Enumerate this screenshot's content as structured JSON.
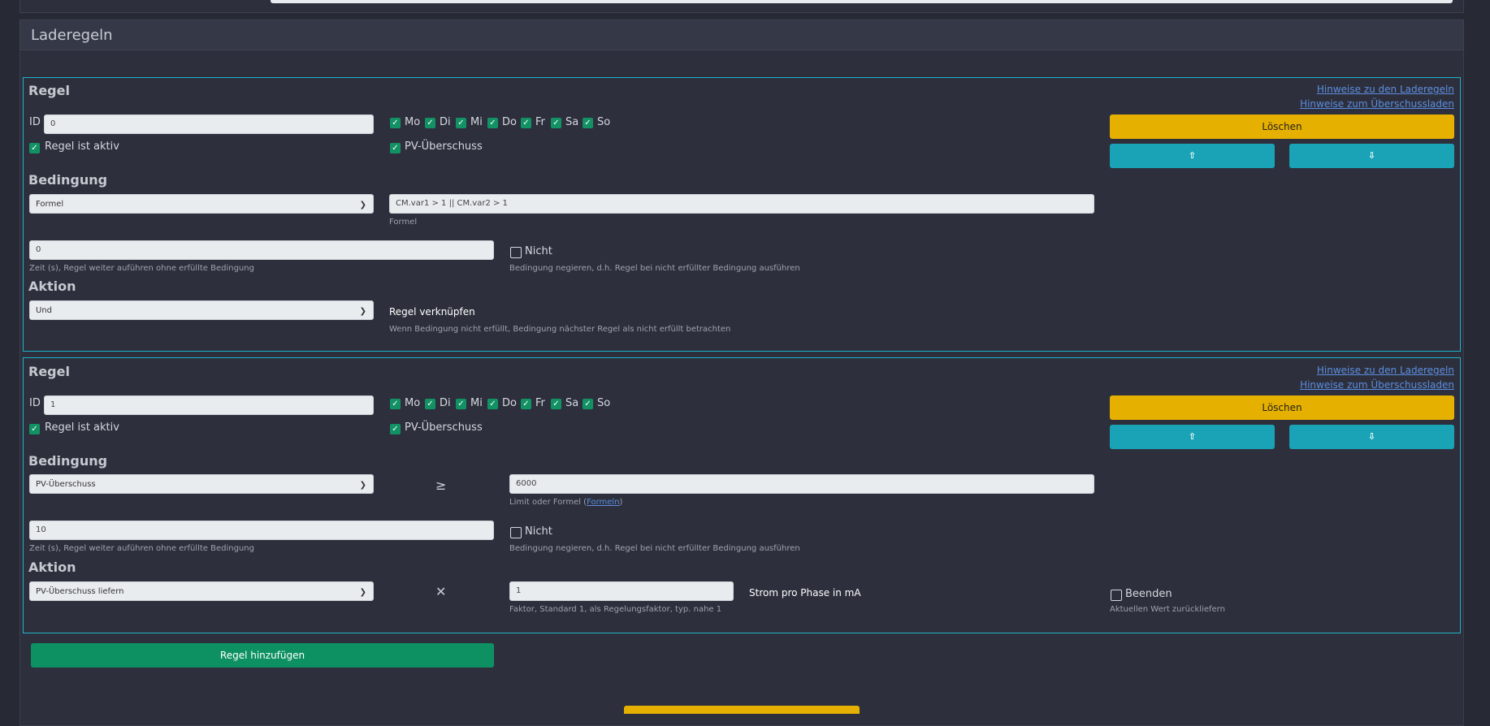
{
  "section": {
    "title": "Laderegeln"
  },
  "common": {
    "rule_title": "Regel",
    "link_rules": "Hinweise zu den Laderegeln",
    "link_surplus": "Hinweise zum Überschussladen",
    "id_label": "ID",
    "active_label": "Regel ist aktiv",
    "pv_label": "PV-Überschuss",
    "days": [
      "Mo",
      "Di",
      "Mi",
      "Do",
      "Fr",
      "Sa",
      "So"
    ],
    "delete_label": "Löschen",
    "move_up_icon": "⇧",
    "move_down_icon": "⇩",
    "condition_title": "Bedingung",
    "action_title": "Aktion",
    "time_help": "Zeit (s), Regel weiter auführen ohne erfüllte Bedingung",
    "not_label": "Nicht",
    "not_help": "Bedingung negieren, d.h. Regel bei nicht erfüllter Bedingung ausführen"
  },
  "rules": [
    {
      "id": "0",
      "condition_type": "Formel",
      "formula": "CM.var1 > 1 || CM.var2 > 1",
      "formula_help": "Formel",
      "time": "0",
      "action": "Und",
      "link_label": "Regel verknüpfen",
      "link_help": "Wenn Bedingung nicht erfüllt, Bedingung nächster Regel als nicht erfüllt betrachten"
    },
    {
      "id": "1",
      "condition_type": "PV-Überschuss",
      "operator": "≥",
      "limit": "6000",
      "limit_help_prefix": "Limit oder Formel (",
      "limit_help_link": "Formeln",
      "limit_help_suffix": ")",
      "time": "10",
      "action": "PV-Überschuss liefern",
      "multiply": "✕",
      "factor": "1",
      "factor_help": "Faktor, Standard 1, als Regelungsfaktor, typ. nahe 1",
      "unit_label": "Strom pro Phase in mA",
      "end_label": "Beenden",
      "end_help": "Aktuellen Wert zurückliefern"
    }
  ],
  "add_rule_label": "Regel hinzufügen"
}
